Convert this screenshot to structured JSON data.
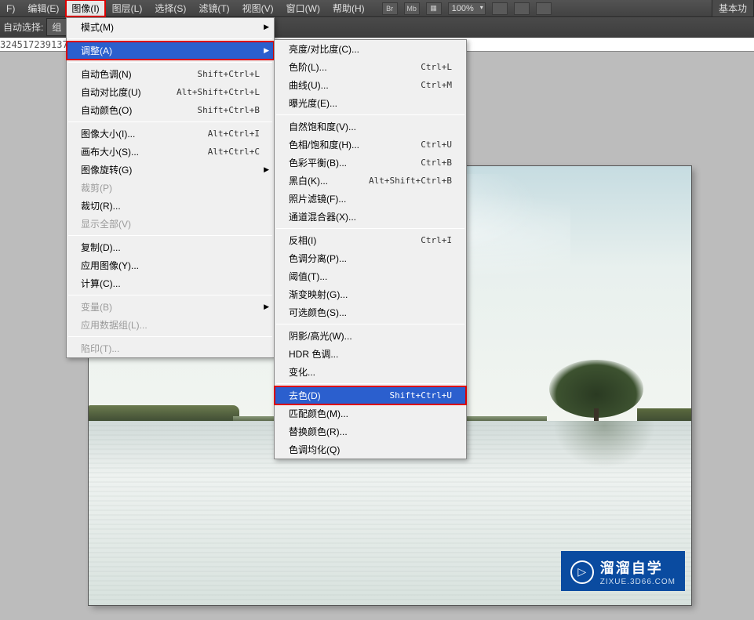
{
  "menubar": {
    "items": [
      "F)",
      "编辑(E)",
      "图像(I)",
      "图层(L)",
      "选择(S)",
      "滤镜(T)",
      "视图(V)",
      "窗口(W)",
      "帮助(H)"
    ],
    "highlighted_index": 2,
    "toolbar_icons": [
      "Br",
      "Mb",
      "▦"
    ],
    "zoom": "100%",
    "layout_icons": [
      "▭",
      "▭",
      "▭"
    ],
    "right_button": "基本功"
  },
  "optbar": {
    "label": "自动选择:",
    "value": "组"
  },
  "ruler": {
    "numbers": "324517239137"
  },
  "menu1": {
    "groups": [
      [
        {
          "label": "模式(M)",
          "arrow": true
        }
      ],
      [
        {
          "label": "调整(A)",
          "arrow": true,
          "hl": true,
          "redbox": true
        }
      ],
      [
        {
          "label": "自动色调(N)",
          "shortcut": "Shift+Ctrl+L"
        },
        {
          "label": "自动对比度(U)",
          "shortcut": "Alt+Shift+Ctrl+L"
        },
        {
          "label": "自动颜色(O)",
          "shortcut": "Shift+Ctrl+B"
        }
      ],
      [
        {
          "label": "图像大小(I)...",
          "shortcut": "Alt+Ctrl+I"
        },
        {
          "label": "画布大小(S)...",
          "shortcut": "Alt+Ctrl+C"
        },
        {
          "label": "图像旋转(G)",
          "arrow": true
        },
        {
          "label": "裁剪(P)",
          "disabled": true
        },
        {
          "label": "裁切(R)..."
        },
        {
          "label": "显示全部(V)",
          "disabled": true
        }
      ],
      [
        {
          "label": "复制(D)..."
        },
        {
          "label": "应用图像(Y)..."
        },
        {
          "label": "计算(C)..."
        }
      ],
      [
        {
          "label": "变量(B)",
          "arrow": true,
          "disabled": true
        },
        {
          "label": "应用数据组(L)...",
          "disabled": true
        }
      ],
      [
        {
          "label": "陷印(T)...",
          "disabled": true
        }
      ]
    ]
  },
  "menu2": {
    "groups": [
      [
        {
          "label": "亮度/对比度(C)..."
        },
        {
          "label": "色阶(L)...",
          "shortcut": "Ctrl+L"
        },
        {
          "label": "曲线(U)...",
          "shortcut": "Ctrl+M"
        },
        {
          "label": "曝光度(E)..."
        }
      ],
      [
        {
          "label": "自然饱和度(V)..."
        },
        {
          "label": "色相/饱和度(H)...",
          "shortcut": "Ctrl+U"
        },
        {
          "label": "色彩平衡(B)...",
          "shortcut": "Ctrl+B"
        },
        {
          "label": "黑白(K)...",
          "shortcut": "Alt+Shift+Ctrl+B"
        },
        {
          "label": "照片滤镜(F)..."
        },
        {
          "label": "通道混合器(X)..."
        }
      ],
      [
        {
          "label": "反相(I)",
          "shortcut": "Ctrl+I"
        },
        {
          "label": "色调分离(P)..."
        },
        {
          "label": "阈值(T)..."
        },
        {
          "label": "渐变映射(G)..."
        },
        {
          "label": "可选颜色(S)..."
        }
      ],
      [
        {
          "label": "阴影/高光(W)..."
        },
        {
          "label": "HDR 色调..."
        },
        {
          "label": "变化..."
        }
      ],
      [
        {
          "label": "去色(D)",
          "shortcut": "Shift+Ctrl+U",
          "hl": true,
          "redbox": true
        },
        {
          "label": "匹配颜色(M)..."
        },
        {
          "label": "替换颜色(R)..."
        },
        {
          "label": "色调均化(Q)"
        }
      ]
    ]
  },
  "watermark": {
    "icon": "▷",
    "big": "溜溜自学",
    "small": "ZIXUE.3D66.COM"
  }
}
